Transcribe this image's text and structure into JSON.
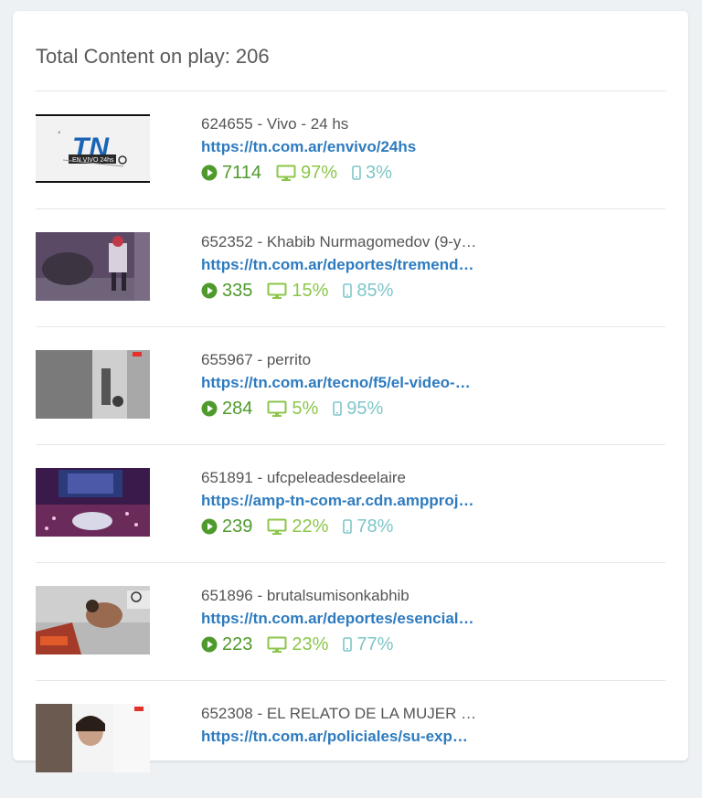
{
  "header": {
    "title": "Total Content on play: 206"
  },
  "colors": {
    "plays": "#4f9a2c",
    "desktop": "#8cc64a",
    "mobile": "#7ec6c8",
    "link": "#2e7bbf"
  },
  "icons": {
    "plays": "play-circle-icon",
    "desktop": "desktop-icon",
    "mobile": "mobile-icon"
  },
  "items": [
    {
      "name": "624655 - Vivo - 24 hs",
      "url": "https://tn.com.ar/envivo/24hs",
      "plays": "7114",
      "desktop": "97%",
      "mobile": "3%",
      "thumb_logo": "TN",
      "thumb_caption": "EN VIVO 24hs"
    },
    {
      "name": "652352 - Khabib Nurmagomedov (9-y…",
      "url": "https://tn.com.ar/deportes/tremend…",
      "plays": "335",
      "desktop": "15%",
      "mobile": "85%"
    },
    {
      "name": "655967 - perrito",
      "url": "https://tn.com.ar/tecno/f5/el-video-…",
      "plays": "284",
      "desktop": "5%",
      "mobile": "95%"
    },
    {
      "name": "651891 - ufcpeleadesdeelaire",
      "url": "https://amp-tn-com-ar.cdn.ampproj…",
      "plays": "239",
      "desktop": "22%",
      "mobile": "78%"
    },
    {
      "name": "651896 - brutalsumisonkabhib",
      "url": "https://tn.com.ar/deportes/esencial…",
      "plays": "223",
      "desktop": "23%",
      "mobile": "77%"
    },
    {
      "name": "652308 - EL RELATO DE LA MUJER …",
      "url": "https://tn.com.ar/policiales/su-exp…",
      "plays": "",
      "desktop": "",
      "mobile": ""
    }
  ]
}
